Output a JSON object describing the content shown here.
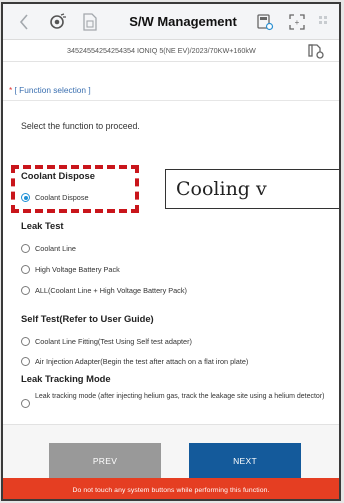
{
  "header": {
    "title": "S/W Management",
    "back_icon": "chevron-left-icon",
    "left_icons": [
      "device-icon",
      "document-icon"
    ],
    "right_icons": [
      "settings-device-icon",
      "fullscreen-icon",
      "grid-icon"
    ]
  },
  "vehicle": {
    "info": "34524554254254354   IONIQ 5(NE EV)/2023/70KW+160kW",
    "icon": "vehicle-settings-icon"
  },
  "section_title": "[ Function selection ]",
  "instruction": "Select the function to proceed.",
  "groups": {
    "coolant_dispose": {
      "label": "Coolant Dispose",
      "options": [
        {
          "label": "Coolant Dispose",
          "selected": true
        }
      ]
    },
    "leak_test": {
      "label": "Leak Test",
      "options": [
        {
          "label": "Coolant Line",
          "selected": false
        },
        {
          "label": "High Voltage Battery Pack",
          "selected": false
        },
        {
          "label": "ALL(Coolant Line + High Voltage Battery Pack)",
          "selected": false
        }
      ]
    },
    "self_test": {
      "label": "Self Test(Refer to User Guide)",
      "options": [
        {
          "label": "Coolant Line Fitting(Test Using Self test adapter)",
          "selected": false
        },
        {
          "label": "Air Injection Adapter(Begin the test after attach on a flat iron plate)",
          "selected": false
        }
      ]
    },
    "leak_tracking": {
      "label": "Leak Tracking Mode",
      "options": [
        {
          "label": "Leak tracking mode (after injecting helium gas, track the leakage site using a helium detector)",
          "selected": false
        }
      ]
    }
  },
  "callout_text": "Cooling v",
  "buttons": {
    "prev": "PREV",
    "next": "NEXT"
  },
  "warning": "Do not touch any system buttons while performing this function.",
  "colors": {
    "accent": "#145a9b",
    "radio_selected": "#1e90d6",
    "warning_bg": "#e53e22",
    "highlight": "#c9151b"
  }
}
